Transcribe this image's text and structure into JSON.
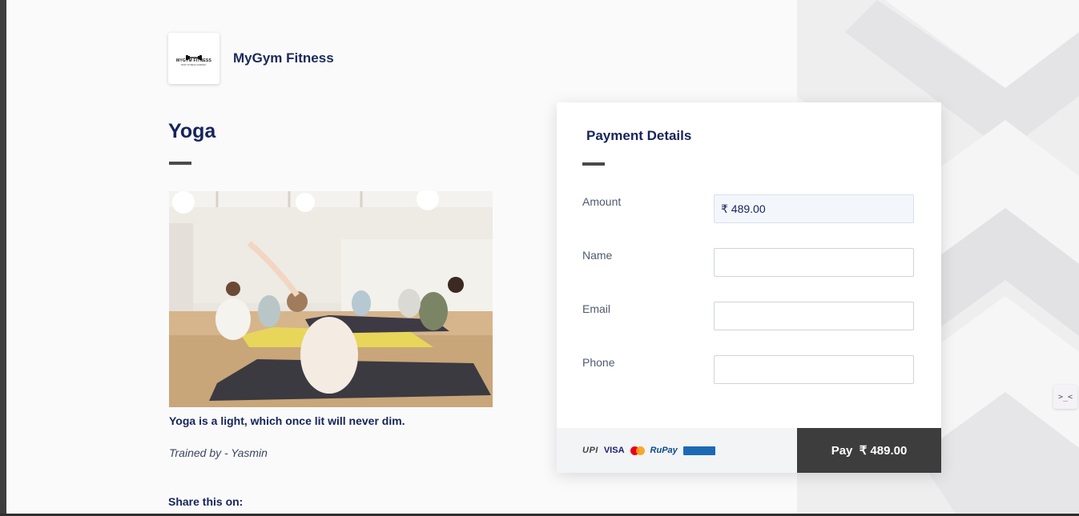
{
  "header": {
    "brand_name": "MyGym Fitness",
    "logo_text": "MYGYM FITNESS",
    "logo_subtext": "BODY FITNESS COMPANY"
  },
  "product": {
    "title": "Yoga",
    "image_alt": "Group yoga class stretching on mats",
    "description": "Yoga is a light, which once lit will never dim.",
    "trainer": "Trained by - Yasmin",
    "share_label": "Share this on:"
  },
  "payment": {
    "title": "Payment Details",
    "fields": {
      "amount": {
        "label": "Amount",
        "value": "₹ 489.00"
      },
      "name": {
        "label": "Name",
        "value": ""
      },
      "email": {
        "label": "Email",
        "value": ""
      },
      "phone": {
        "label": "Phone",
        "value": ""
      }
    },
    "methods": {
      "upi": "UPI",
      "visa": "VISA",
      "rupay": "RuPay"
    },
    "pay_button": "Pay  ₹ 489.00"
  },
  "widget": {
    "label": ">_<"
  },
  "colors": {
    "primary_text": "#15255a",
    "pay_button_bg": "#3d3d3d",
    "accent_bar": "#4a4a4a"
  }
}
